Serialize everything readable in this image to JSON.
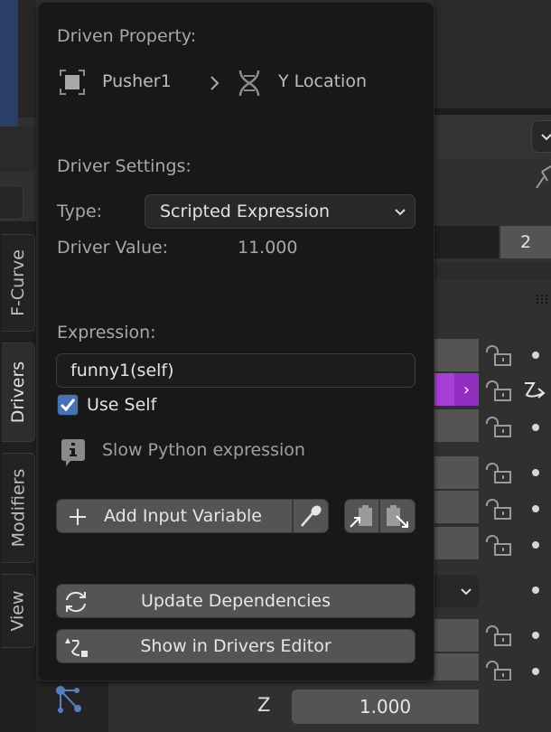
{
  "background": {
    "side_tabs": [
      {
        "label": "F-Curve",
        "active": false
      },
      {
        "label": "Drivers",
        "active": true
      },
      {
        "label": "Modifiers",
        "active": false
      },
      {
        "label": "View",
        "active": false
      }
    ],
    "right_field_value": "2",
    "z_axis_label": "Z",
    "z_value": "1.000"
  },
  "popover": {
    "driven_property_label": "Driven Property:",
    "object_name": "Pusher1",
    "separator": ">",
    "property_name": "Y Location",
    "driver_settings_label": "Driver Settings:",
    "type_label": "Type:",
    "type_value": "Scripted Expression",
    "driver_value_label": "Driver Value:",
    "driver_value": "11.000",
    "expression_label": "Expression:",
    "expression_value": "funny1(self)",
    "use_self_label": "Use Self",
    "use_self_checked": true,
    "info_message": "Slow Python expression",
    "add_input_variable_label": "Add Input Variable",
    "update_dependencies_label": "Update Dependencies",
    "show_in_drivers_editor_label": "Show in Drivers Editor"
  },
  "colors": {
    "checkbox_accent": "#4772b3",
    "driven_field": "#a83ed8",
    "graph_icon": "#5680c2"
  }
}
